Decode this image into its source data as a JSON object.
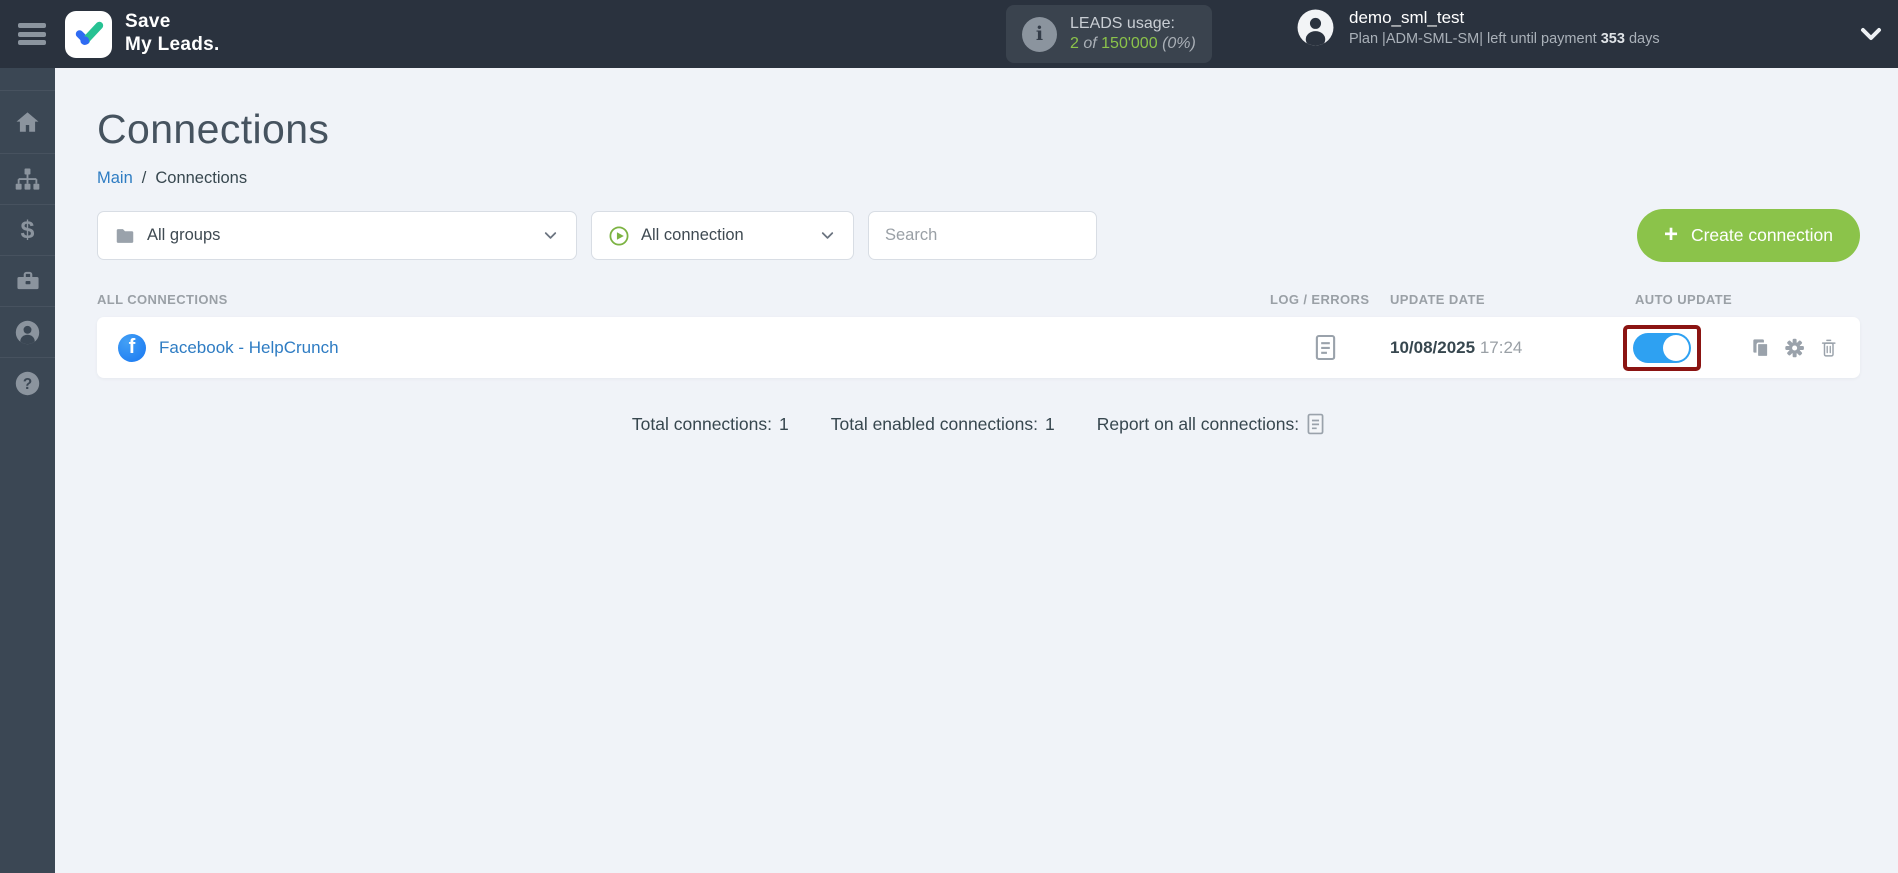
{
  "colors": {
    "accent_green": "#8bc34a",
    "toggle_blue": "#2ea1f2",
    "highlight_red": "#8b1412",
    "link_blue": "#2e7cc3",
    "header_bg": "#2a323e",
    "sidebar_bg": "#3b4754"
  },
  "header": {
    "brand": {
      "line1": "Save",
      "line2": "My Leads."
    },
    "leads_usage": {
      "label": "LEADS usage:",
      "used": "2",
      "of": "of",
      "total": "150'000",
      "percent": "(0%)",
      "info_glyph": "i"
    },
    "user": {
      "name": "demo_sml_test",
      "plan_before": "Plan |ADM-SML-SM| left until payment",
      "days": "353",
      "days_after": "days"
    }
  },
  "sidebar": {
    "dollar_glyph": "$",
    "help_glyph": "?"
  },
  "page": {
    "title": "Connections",
    "breadcrumb": {
      "link": "Main",
      "separator": "/",
      "current": "Connections"
    }
  },
  "filters": {
    "group_filter": "All groups",
    "connection_filter": "All connection",
    "search_placeholder": "Search",
    "create_button": "Create connection",
    "plus_glyph": "+"
  },
  "table": {
    "headers": {
      "connections": "ALL CONNECTIONS",
      "log": "LOG / ERRORS",
      "update_date": "UPDATE DATE",
      "auto_update": "AUTO UPDATE"
    },
    "rows": [
      {
        "name": "Facebook - HelpCrunch",
        "facebook_glyph": "f",
        "update_date": "10/08/2025",
        "update_time": "17:24",
        "auto_update_on": true
      }
    ]
  },
  "summary": {
    "total_label": "Total connections:",
    "total_value": "1",
    "enabled_label": "Total enabled connections:",
    "enabled_value": "1",
    "report_label": "Report on all connections:"
  }
}
